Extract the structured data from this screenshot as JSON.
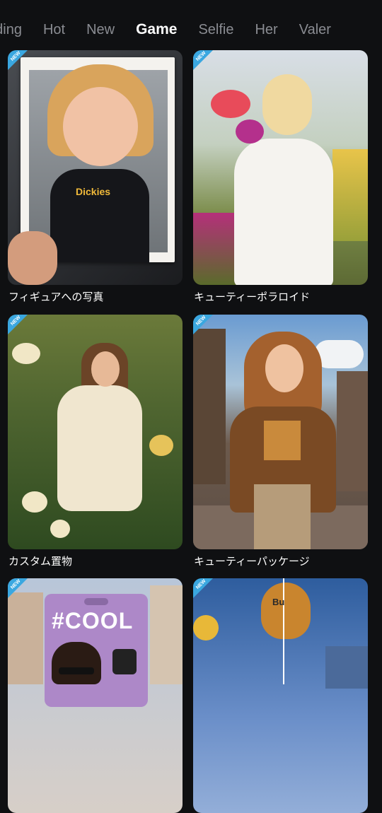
{
  "tabs": [
    {
      "label": "nding",
      "active": false
    },
    {
      "label": "Hot",
      "active": false
    },
    {
      "label": "New",
      "active": false
    },
    {
      "label": "Game",
      "active": true
    },
    {
      "label": "Selfie",
      "active": false
    },
    {
      "label": "Her",
      "active": false
    },
    {
      "label": "Valer",
      "active": false
    }
  ],
  "cards": [
    {
      "title": "フィギュアへの写真",
      "badge": "NEW",
      "image": "figure-polaroid-photo"
    },
    {
      "title": "キューティーポラロイド",
      "badge": "NEW",
      "image": "woman-with-tulips-photo"
    },
    {
      "title": "カスタム置物",
      "badge": "NEW",
      "image": "woman-in-flower-field-photo"
    },
    {
      "title": "キューティーパッケージ",
      "badge": "NEW",
      "image": "woman-walking-street-photo"
    },
    {
      "title": "",
      "badge": "NEW",
      "image": "cool-toy-package-photo",
      "package_text": "#COOL"
    },
    {
      "title": "",
      "badge": "NEW",
      "image": "hot-air-balloons-photo",
      "balloon_text": "Bu"
    }
  ],
  "colors": {
    "background": "#0f1012",
    "tab_inactive": "#8a8c92",
    "tab_active": "#ffffff",
    "badge": "#3aa7e0"
  }
}
